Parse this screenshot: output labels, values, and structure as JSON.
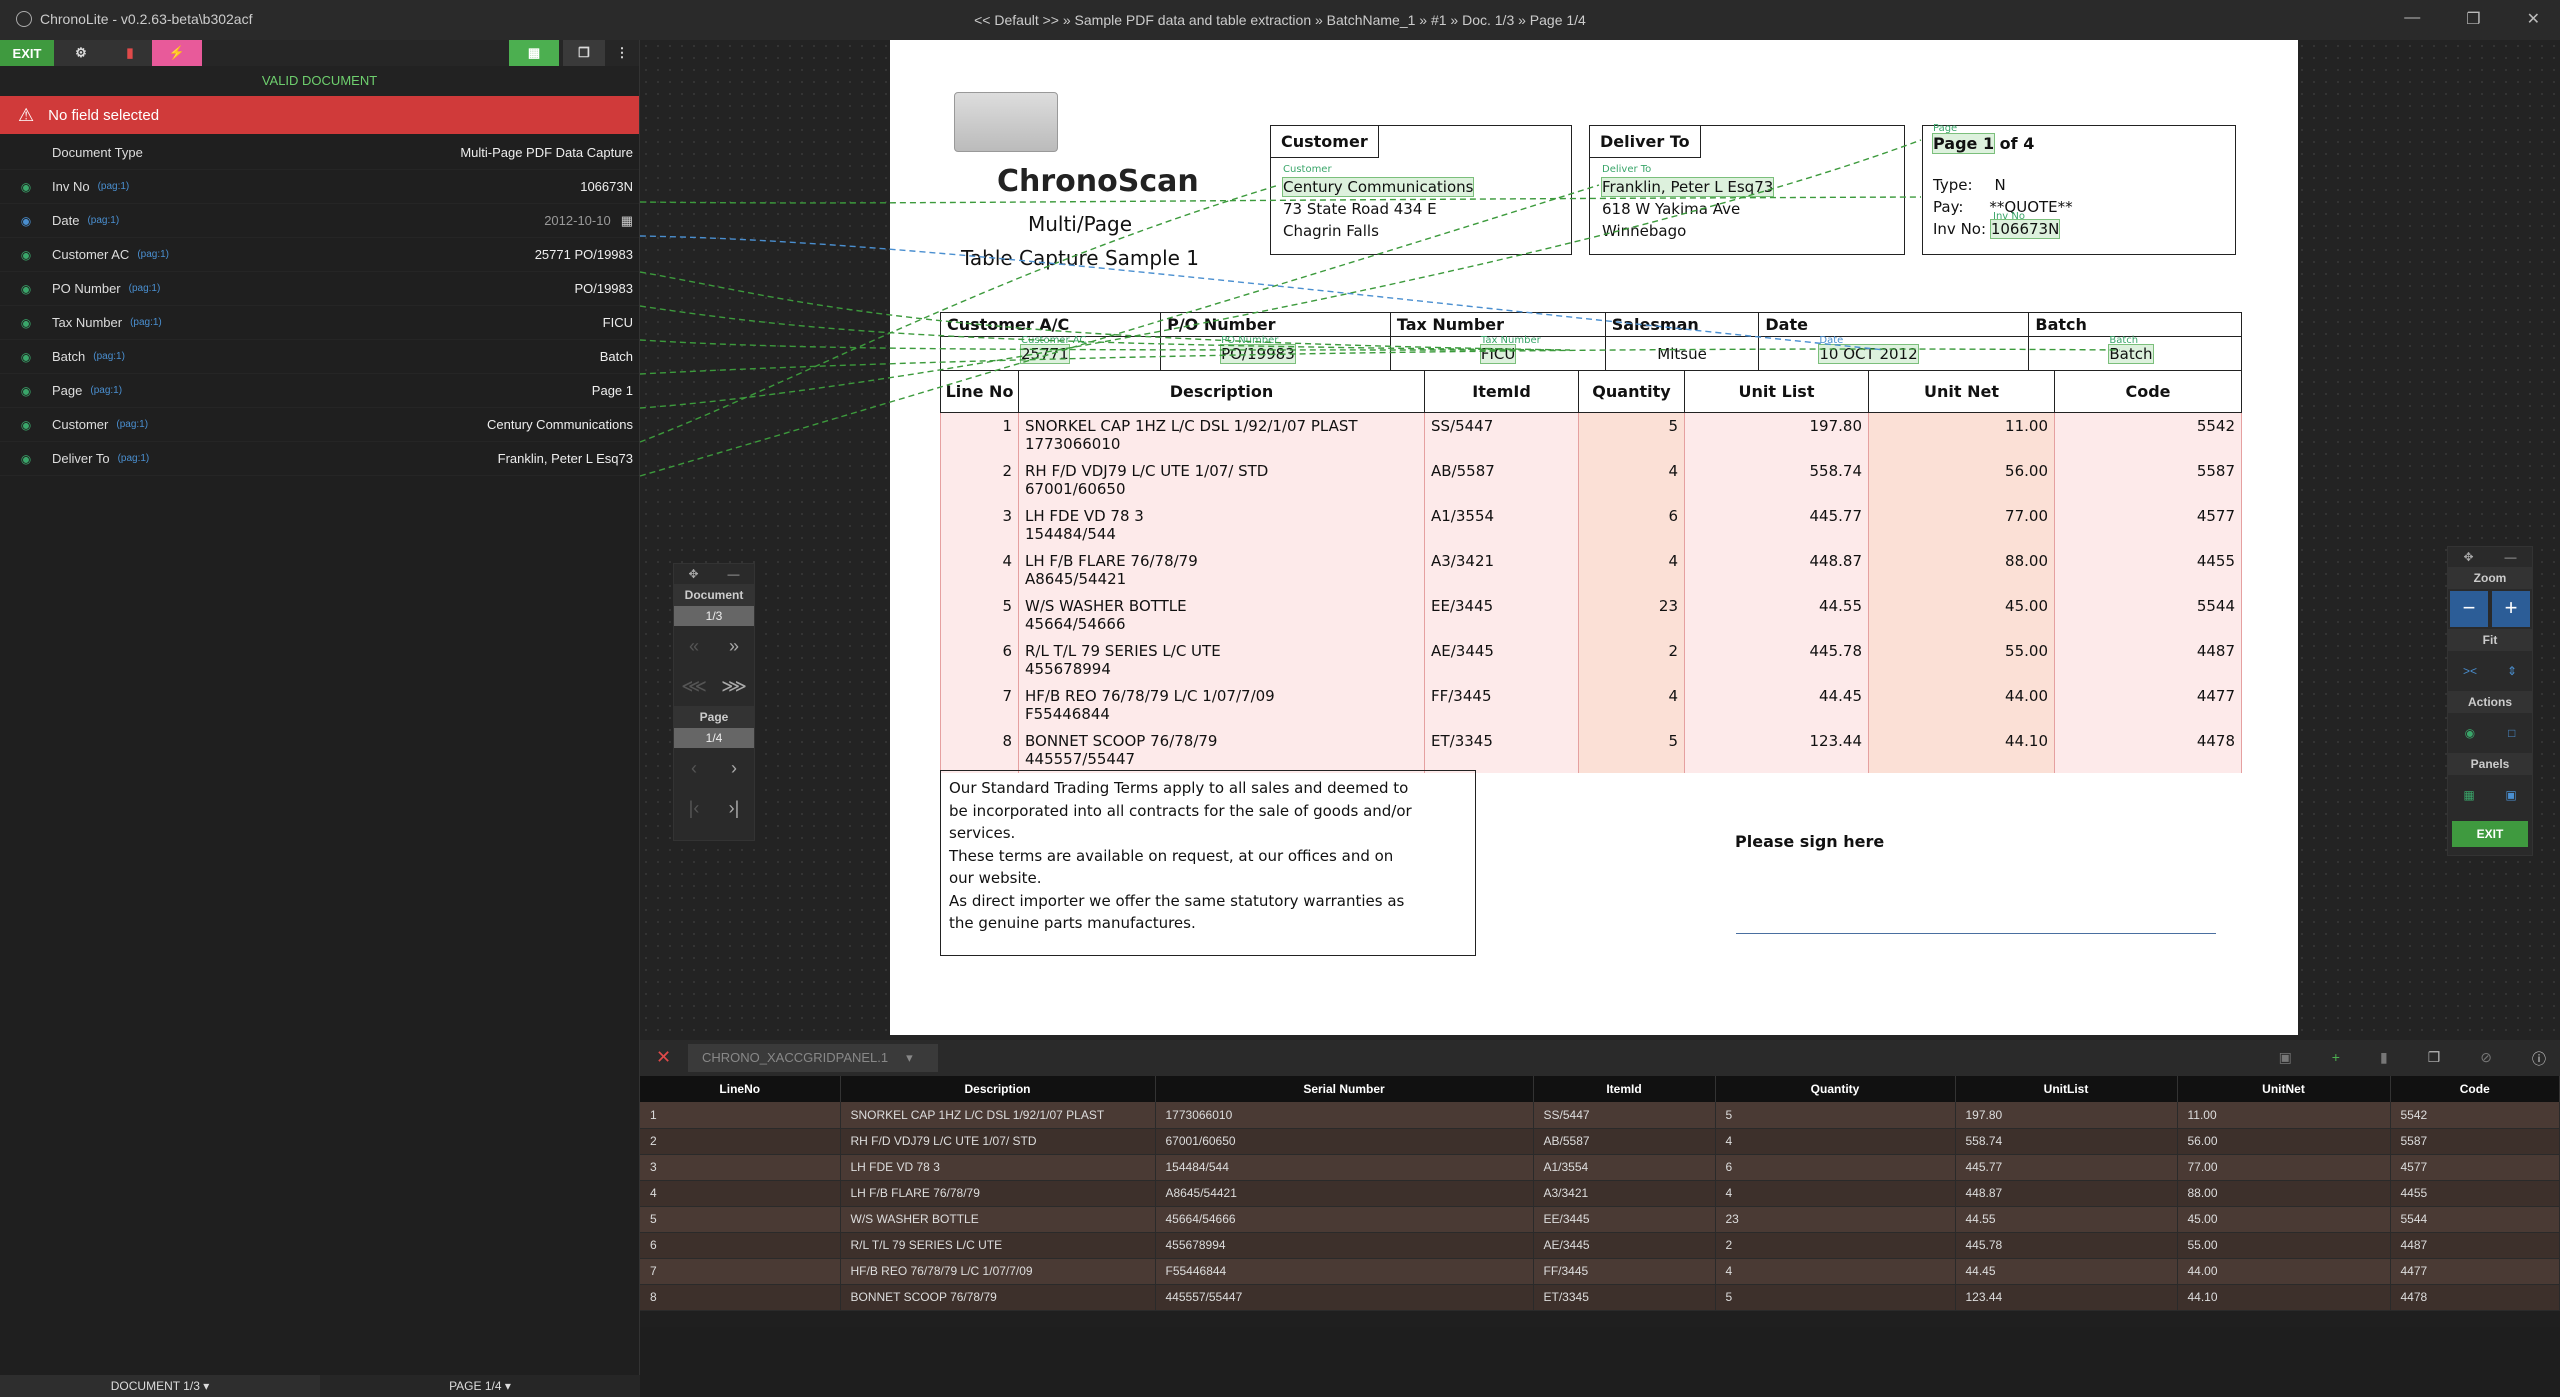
{
  "window": {
    "app_title": "ChronoLite - v0.2.63-beta\\b302acf",
    "path": "<< Default >> » Sample PDF data and table extraction » BatchName_1 » #1 » Doc. 1/3 » Page 1/4"
  },
  "toolbar": {
    "exit_label": "EXIT"
  },
  "status": {
    "valid": "VALID DOCUMENT",
    "alert": "No field selected"
  },
  "fields": [
    {
      "label": "Document Type",
      "pag": "",
      "value": "Multi-Page PDF Data Capture"
    },
    {
      "label": "Inv No",
      "pag": "(pag:1)",
      "value": "106673N"
    },
    {
      "label": "Date",
      "pag": "(pag:1)",
      "value": "2012-10-10"
    },
    {
      "label": "Customer AC",
      "pag": "(pag:1)",
      "value": "25771 PO/19983"
    },
    {
      "label": "PO Number",
      "pag": "(pag:1)",
      "value": "PO/19983"
    },
    {
      "label": "Tax Number",
      "pag": "(pag:1)",
      "value": "FICU"
    },
    {
      "label": "Batch",
      "pag": "(pag:1)",
      "value": "Batch"
    },
    {
      "label": "Page",
      "pag": "(pag:1)",
      "value": "Page 1"
    },
    {
      "label": "Customer",
      "pag": "(pag:1)",
      "value": "Century Communications"
    },
    {
      "label": "Deliver To",
      "pag": "(pag:1)",
      "value": "Franklin, Peter L Esq73"
    }
  ],
  "bottom_tabs": {
    "document": "DOCUMENT 1/3",
    "page": "PAGE 1/4"
  },
  "nav": {
    "document_label": "Document",
    "document_count": "1/3",
    "page_label": "Page",
    "page_count": "1/4"
  },
  "zoom": {
    "zoom_label": "Zoom",
    "fit_label": "Fit",
    "actions_label": "Actions",
    "panels_label": "Panels",
    "exit_label": "EXIT"
  },
  "doc": {
    "brand": "ChronoScan",
    "subtitle1": "Multi/Page",
    "subtitle2": "Table Capture Sample 1",
    "customer_title": "Customer",
    "customer_tag": "Customer",
    "customer_name": "Century Communications",
    "customer_addr1": "73 State Road 434 E",
    "customer_addr2": "Chagrin Falls",
    "deliver_title": "Deliver To",
    "deliver_tag": "Deliver To",
    "deliver_name": "Franklin, Peter L Esq73",
    "deliver_addr1": "618 W Yakima Ave",
    "deliver_addr2": "Winnebago",
    "page_tag": "Page",
    "page_text": "Page 1",
    "page_of": " of 4",
    "type_label": "Type:",
    "type_value": "N",
    "pay_label": "Pay:",
    "pay_value": "**QUOTE**",
    "invno_tag": "Inv No",
    "invno_label": "Inv No:",
    "invno_value": "106673N",
    "info_headers": [
      "Customer A/C",
      "P/O Number",
      "Tax Number",
      "Salesman",
      "Date",
      "Batch"
    ],
    "info_tags": [
      "Customer AC",
      "PO Number",
      "Tax Number",
      "",
      "Date",
      "Batch"
    ],
    "info_values": [
      "25771",
      "PO/19983",
      "FICU",
      "Mitsue",
      "10 OCT 2012",
      "Batch"
    ],
    "line_headers": [
      "Line No",
      "Description",
      "ItemId",
      "Quantity",
      "Unit List",
      "Unit Net",
      "Code"
    ],
    "lines": [
      {
        "no": "1",
        "d1": "SNORKEL CAP 1HZ L/C DSL 1/92/1/07 PLAST",
        "d2": "1773066010",
        "item": "SS/5447",
        "qty": "5",
        "list": "197.80",
        "net": "11.00",
        "code": "5542"
      },
      {
        "no": "2",
        "d1": "RH F/D VDJ79 L/C UTE 1/07/ STD",
        "d2": "67001/60650",
        "item": "AB/5587",
        "qty": "4",
        "list": "558.74",
        "net": "56.00",
        "code": "5587"
      },
      {
        "no": "3",
        "d1": "LH FDE VD 78 3",
        "d2": "154484/544",
        "item": "A1/3554",
        "qty": "6",
        "list": "445.77",
        "net": "77.00",
        "code": "4577"
      },
      {
        "no": "4",
        "d1": "LH F/B FLARE 76/78/79",
        "d2": "A8645/54421",
        "item": "A3/3421",
        "qty": "4",
        "list": "448.87",
        "net": "88.00",
        "code": "4455"
      },
      {
        "no": "5",
        "d1": "W/S WASHER BOTTLE",
        "d2": "45664/54666",
        "item": "EE/3445",
        "qty": "23",
        "list": "44.55",
        "net": "45.00",
        "code": "5544"
      },
      {
        "no": "6",
        "d1": "R/L T/L 79 SERIES L/C UTE",
        "d2": "455678994",
        "item": "AE/3445",
        "qty": "2",
        "list": "445.78",
        "net": "55.00",
        "code": "4487"
      },
      {
        "no": "7",
        "d1": "HF/B REO 76/78/79 L/C 1/07/7/09",
        "d2": "F55446844",
        "item": "FF/3445",
        "qty": "4",
        "list": "44.45",
        "net": "44.00",
        "code": "4477"
      },
      {
        "no": "8",
        "d1": "BONNET SCOOP 76/78/79",
        "d2": "445557/55447",
        "item": "ET/3345",
        "qty": "5",
        "list": "123.44",
        "net": "44.10",
        "code": "4478"
      }
    ],
    "terms": [
      "Our Standard Trading Terms apply to all sales and deemed to",
      "be incorporated into all contracts for the sale of goods and/or",
      "services.",
      "These terms are available on request, at our offices and on",
      "our website.",
      "As direct importer we offer the same statutory warranties as",
      "the genuine parts manufactures."
    ],
    "sign": "Please sign here"
  },
  "grid": {
    "tab_name": "CHRONO_XACCGRIDPANEL.1",
    "headers": [
      "LineNo",
      "Description",
      "Serial Number",
      "ItemId",
      "Quantity",
      "UnitList",
      "UnitNet",
      "Code"
    ],
    "rows": [
      [
        "1",
        "SNORKEL CAP 1HZ L/C DSL 1/92/1/07 PLAST",
        "1773066010",
        "SS/5447",
        "5",
        "197.80",
        "11.00",
        "5542"
      ],
      [
        "2",
        "RH F/D VDJ79 L/C UTE 1/07/ STD",
        "67001/60650",
        "AB/5587",
        "4",
        "558.74",
        "56.00",
        "5587"
      ],
      [
        "3",
        "LH FDE VD 78 3",
        "154484/544",
        "A1/3554",
        "6",
        "445.77",
        "77.00",
        "4577"
      ],
      [
        "4",
        "LH F/B FLARE 76/78/79",
        "A8645/54421",
        "A3/3421",
        "4",
        "448.87",
        "88.00",
        "4455"
      ],
      [
        "5",
        "W/S WASHER BOTTLE",
        "45664/54666",
        "EE/3445",
        "23",
        "44.55",
        "45.00",
        "5544"
      ],
      [
        "6",
        "R/L T/L 79 SERIES L/C UTE",
        "455678994",
        "AE/3445",
        "2",
        "445.78",
        "55.00",
        "4487"
      ],
      [
        "7",
        "HF/B REO 76/78/79 L/C 1/07/7/09",
        "F55446844",
        "FF/3445",
        "4",
        "44.45",
        "44.00",
        "4477"
      ],
      [
        "8",
        "BONNET SCOOP 76/78/79",
        "445557/55447",
        "ET/3345",
        "5",
        "123.44",
        "44.10",
        "4478"
      ]
    ]
  }
}
